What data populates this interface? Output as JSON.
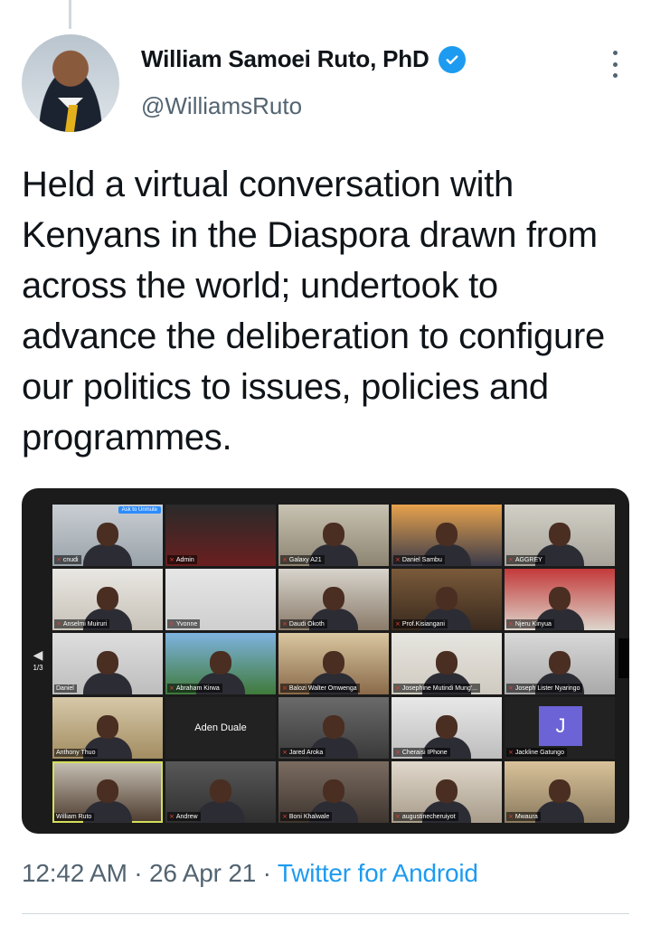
{
  "author": {
    "display_name": "William Samoei Ruto, PhD",
    "handle": "@WilliamsRuto",
    "verified": true,
    "verified_color": "#1d9bf0"
  },
  "tweet": {
    "text": "Held a virtual conversation with Kenyans in the Diaspora drawn from across the world; undertook to advance the deliberation to configure our politics to issues, policies and programmes."
  },
  "media": {
    "page_indicator": "1/3",
    "unmute_prompt": "Ask to Unmute",
    "participants": [
      {
        "name": "cnudi"
      },
      {
        "name": "Admin"
      },
      {
        "name": "Galaxy A21"
      },
      {
        "name": "Daniel Sambu"
      },
      {
        "name": "AGGREY"
      },
      {
        "name": "Anselmi Muiruri"
      },
      {
        "name": "Yvonne"
      },
      {
        "name": "Daudi Okoth"
      },
      {
        "name": "Prof.Kisiangani"
      },
      {
        "name": "Njeru Kinyua"
      },
      {
        "name": "Daniel"
      },
      {
        "name": "Abraham Kirwa"
      },
      {
        "name": "Balozi Walter Omwenga"
      },
      {
        "name": "Josephine Mutindi Mung'..."
      },
      {
        "name": "Joseph Lister Nyaringo"
      },
      {
        "name": "Anthony Thuo"
      },
      {
        "name": "Aden Duale"
      },
      {
        "name": "Jared Aroka"
      },
      {
        "name": "Cheraisi IPhone"
      },
      {
        "name": "Jackline Gatungo"
      },
      {
        "name": "William Ruto"
      },
      {
        "name": "Andrew"
      },
      {
        "name": "Boni Khalwale"
      },
      {
        "name": "augustinecheruiyot"
      },
      {
        "name": "Mwaura"
      }
    ],
    "avatar_initial": "J"
  },
  "meta": {
    "time": "12:42 AM",
    "separator": " · ",
    "date": "26 Apr 21",
    "source": "Twitter for Android"
  }
}
